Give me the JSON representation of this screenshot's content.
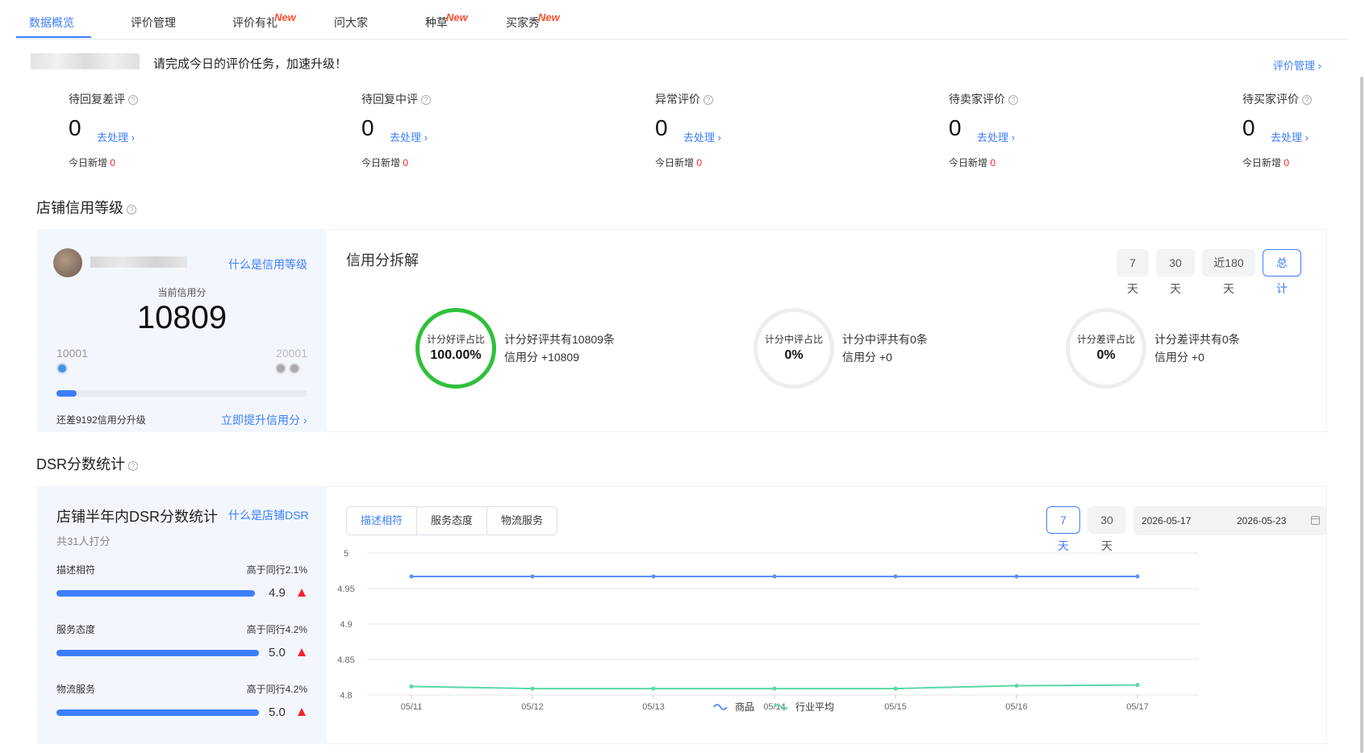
{
  "tabs": [
    {
      "label": "数据概览",
      "new": ""
    },
    {
      "label": "评价管理",
      "new": ""
    },
    {
      "label": "评价有礼",
      "new": "New"
    },
    {
      "label": "问大家",
      "new": ""
    },
    {
      "label": "种草",
      "new": "New"
    },
    {
      "label": "买家秀",
      "new": "New"
    }
  ],
  "notice": {
    "text": "请完成今日的评价任务，加速升级！",
    "link": "评价管理 ›"
  },
  "stats": [
    {
      "label": "待回复差评",
      "value": "0",
      "link": "去处理 ›",
      "today_label": "今日新增",
      "today_value": "0"
    },
    {
      "label": "待回复中评",
      "value": "0",
      "link": "去处理 ›",
      "today_label": "今日新增",
      "today_value": "0"
    },
    {
      "label": "异常评价",
      "value": "0",
      "link": "去处理 ›",
      "today_label": "今日新增",
      "today_value": "0"
    },
    {
      "label": "待卖家评价",
      "value": "0",
      "link": "去处理 ›",
      "today_label": "今日新增",
      "today_value": "0"
    },
    {
      "label": "待买家评价",
      "value": "0",
      "link": "去处理 ›",
      "today_label": "今日新增",
      "today_value": "0"
    }
  ],
  "credit": {
    "section_title": "店铺信用等级",
    "what_link": "什么是信用等级",
    "current_label": "当前信用分",
    "current_value": "10809",
    "level_min": "10001",
    "level_max": "20001",
    "progress": 0.08,
    "upgrade_text": "还差9192信用分升级",
    "upgrade_link": "立即提升信用分 ›",
    "breakdown_title": "信用分拆解",
    "ranges": [
      "7天",
      "30天",
      "近180天",
      "总计"
    ],
    "active_range": 3,
    "rings": [
      {
        "label": "计分好评占比",
        "value": "100.00%",
        "line1": "计分好评共有10809条",
        "line2": "信用分 +10809",
        "color": "#2fc13a"
      },
      {
        "label": "计分中评占比",
        "value": "0%",
        "line1": "计分中评共有0条",
        "line2": "信用分 +0",
        "color": "#eeeeee"
      },
      {
        "label": "计分差评占比",
        "value": "0%",
        "line1": "计分差评共有0条",
        "line2": "信用分 +0",
        "color": "#eeeeee"
      }
    ]
  },
  "dsr": {
    "section_title": "DSR分数统计",
    "title": "店铺半年内DSR分数统计",
    "what_link": "什么是店铺DSR",
    "count": "共31人打分",
    "rows": [
      {
        "label": "描述相符",
        "compare": "高于同行2.1%",
        "score": "4.9",
        "fraction": 0.98
      },
      {
        "label": "服务态度",
        "compare": "高于同行4.2%",
        "score": "5.0",
        "fraction": 1.0
      },
      {
        "label": "物流服务",
        "compare": "高于同行4.2%",
        "score": "5.0",
        "fraction": 1.0
      }
    ],
    "metric_tabs": [
      "描述相符",
      "服务态度",
      "物流服务"
    ],
    "active_metric": 0,
    "ranges": [
      "7天",
      "30天"
    ],
    "active_range": 0,
    "date_start": "2026-05-17",
    "date_end": "2026-05-23"
  },
  "chart_data": {
    "type": "line",
    "x": [
      "05/11",
      "05/12",
      "05/13",
      "05/14",
      "05/15",
      "05/16",
      "05/17"
    ],
    "ylim": [
      4.8,
      5
    ],
    "yticks": [
      "5",
      "4.95",
      "4.9",
      "4.85",
      "4.8"
    ],
    "series": [
      {
        "name": "商品",
        "color": "#5b8ff9",
        "values": [
          4.967,
          4.967,
          4.967,
          4.967,
          4.967,
          4.967,
          4.967
        ]
      },
      {
        "name": "行业平均",
        "color": "#5ad8a6",
        "values": [
          4.812,
          4.809,
          4.809,
          4.809,
          4.809,
          4.813,
          4.814
        ]
      }
    ],
    "legend_position": "bottom",
    "grid": true
  }
}
